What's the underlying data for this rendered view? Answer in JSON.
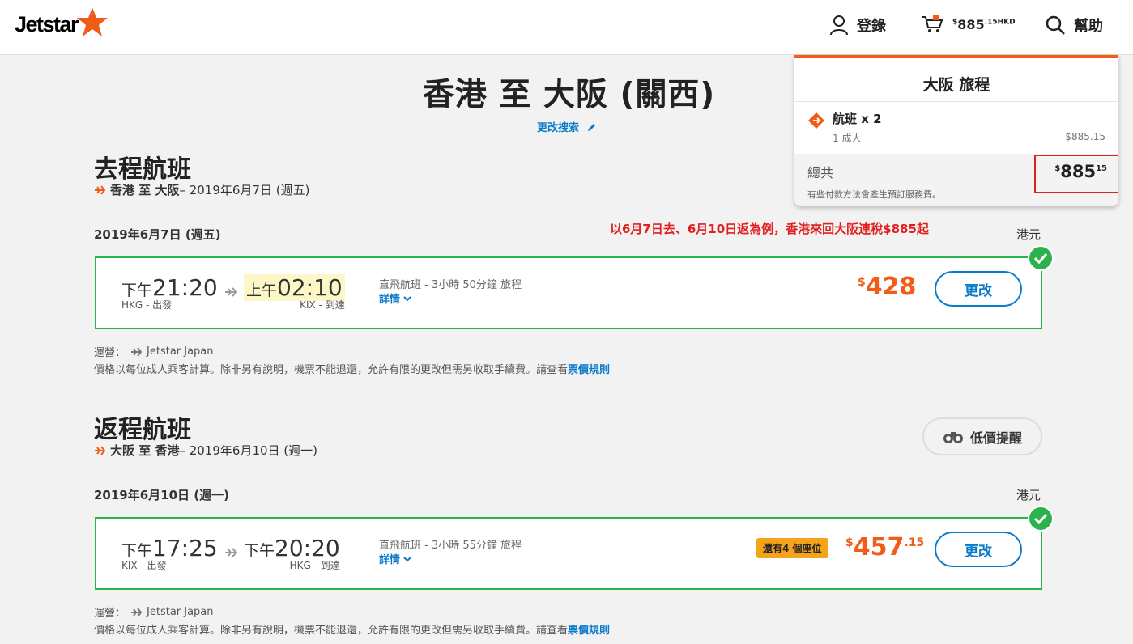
{
  "header": {
    "brand": "Jetstar",
    "login_label": "登錄",
    "cart_amount_main": "885",
    "cart_amount_decimal": ".15",
    "cart_amount_currency": "HKD",
    "cart_amount_prefix": "$",
    "help_label": "幫助"
  },
  "cart_dropdown": {
    "title": "大阪 旅程",
    "item_label": "航班 x 2",
    "item_passengers": "1 成人",
    "item_price": "$885.15",
    "total_label": "總共",
    "total_prefix": "$",
    "total_main": "885",
    "total_decimal": "15",
    "total_note": "有些付款方法會產生預訂服務費。"
  },
  "page": {
    "title": "香港 至 大阪 (關西)",
    "change_search": "更改搜索",
    "promo_note": "以6月7日去、6月10日返為例，香港來回大阪連稅$885起"
  },
  "outbound": {
    "section_title": "去程航班",
    "route": "香港 至 大阪",
    "route_date": " – 2019年6月7日 (週五)",
    "date_label": "2019年6月7日 (週五)",
    "currency_label": "港元",
    "depart_ampm": "下午",
    "depart_time": "21:20",
    "depart_sub": "HKG - 出發",
    "arrive_ampm": "上午",
    "arrive_time": "02:10",
    "arrive_sub": "KIX - 到達",
    "flight_info": "直飛航班 - 3小時 50分鐘 旅程",
    "details_label": "詳情",
    "price_prefix": "$",
    "price_main": "428",
    "price_decimal": "",
    "change_label": "更改",
    "operator_label": "運營：",
    "operator_name": "Jetstar Japan",
    "fare_note": "價格以每位成人乘客計算。除非另有說明，機票不能退還，允許有限的更改但需另收取手續費。請查看",
    "fare_rules_link": "票價規則"
  },
  "return": {
    "section_title": "返程航班",
    "route": "大阪 至 香港",
    "route_date": " – 2019年6月10日 (週一)",
    "price_alert_label": "低價提醒",
    "date_label": "2019年6月10日 (週一)",
    "currency_label": "港元",
    "depart_ampm": "下午",
    "depart_time": "17:25",
    "depart_sub": "KIX - 出發",
    "arrive_ampm": "下午",
    "arrive_time": "20:20",
    "arrive_sub": "HKG - 到達",
    "flight_info": "直飛航班 - 3小時 55分鐘 旅程",
    "details_label": "詳情",
    "seats_badge": "還有4 個座位",
    "price_prefix": "$",
    "price_main": "457",
    "price_decimal": ".15",
    "change_label": "更改",
    "operator_label": "運營：",
    "operator_name": "Jetstar Japan",
    "fare_note": "價格以每位成人乘客計算。除非另有說明，機票不能退還，允許有限的更改但需另收取手續費。請查看",
    "fare_rules_link": "票價規則"
  },
  "colors": {
    "brand_orange": "#f25c19",
    "link_blue": "#0a7acb",
    "selected_green": "#2bb24c",
    "highlight_red": "#e0201f",
    "badge_amber": "#f5a31a"
  }
}
